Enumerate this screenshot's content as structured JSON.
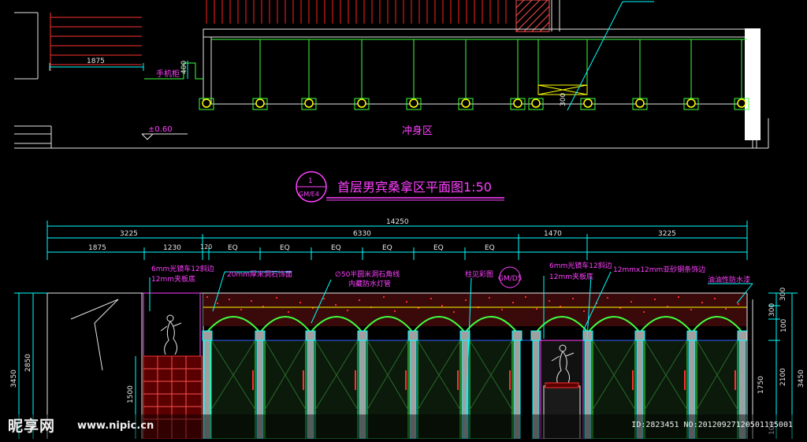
{
  "plan": {
    "level_mark": "±0.60",
    "room_label": "冲身区",
    "phone_cabinet": "手机柜",
    "dim_1875": "1875",
    "dim_400": "400",
    "dim_300": "300"
  },
  "title": {
    "text": "首层男宾桑拿区平面图1:50",
    "index_top": "1",
    "index_bottom": "GM/E4"
  },
  "dimensions": {
    "total": "14250",
    "tier2": [
      "3225",
      "6330",
      "1470",
      "3225"
    ],
    "tier3": [
      "1875",
      "1230",
      "120",
      "EQ",
      "EQ",
      "EQ",
      "EQ",
      "EQ",
      "EQ"
    ],
    "right": [
      "300",
      "300",
      "100",
      "3450",
      "2100",
      "1750",
      "100"
    ],
    "left": [
      "3450",
      "2850",
      "1500"
    ]
  },
  "annotations": {
    "mirror_left_1": "6mm光镜车12斜边",
    "mirror_left_2": "12mm夹板底",
    "marble": "20mm厚米洞石饰面",
    "marble_line_1": "∅50半圆米洞石角线",
    "marble_line_2": "内藏防水灯管",
    "col_see": "柱见彩图",
    "col_index": "GM/D5",
    "mirror_right_1": "6mm光镜车12斜边",
    "mirror_right_2": "12mm夹板底",
    "steel_strip": "12mmx12mm亚砂钢条饰边",
    "paint": "油油性防水漆"
  },
  "watermark": {
    "logo": "昵享网",
    "url": "www.nipic.cn",
    "id_text": "ID:2823451 NO:20120927120501115001"
  }
}
